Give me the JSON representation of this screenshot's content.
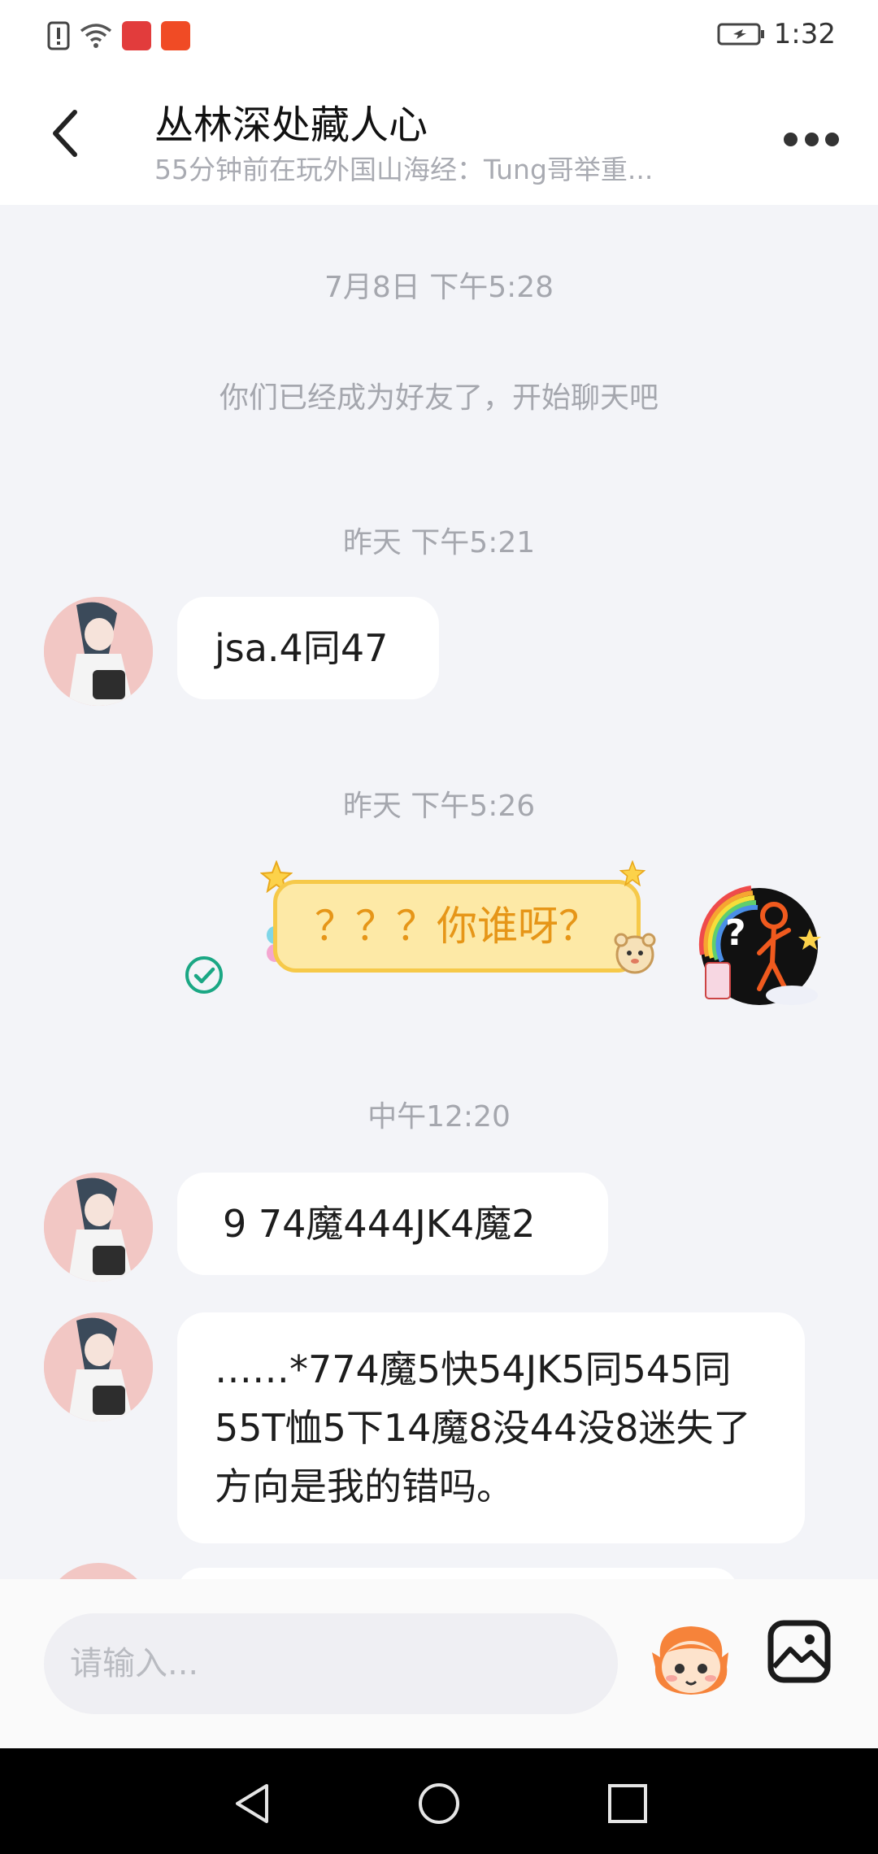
{
  "status_bar": {
    "time": "1:32",
    "icons": [
      "alert-icon",
      "wifi-icon",
      "huawei-app-icon",
      "app-icon",
      "battery-icon"
    ]
  },
  "header": {
    "title": "丛林深处藏人心",
    "subtitle": "55分钟前在玩外国山海经：Tung哥举重...",
    "back_icon": "back-arrow-icon",
    "more_icon": "more-dots-icon"
  },
  "chat": {
    "messages": [
      {
        "type": "timestamp",
        "text": "7月8日 下午5:28"
      },
      {
        "type": "system",
        "text": "你们已经成为好友了，开始聊天吧"
      },
      {
        "type": "timestamp",
        "text": "昨天 下午5:21"
      },
      {
        "type": "received",
        "text": "jsa.4同47"
      },
      {
        "type": "timestamp",
        "text": "昨天 下午5:26"
      },
      {
        "type": "sent_sticker",
        "text": "？？？你谁呀？",
        "status": "sent"
      },
      {
        "type": "timestamp",
        "text": "中午12:20"
      },
      {
        "type": "received",
        "text": "9 74魔444JK4魔2"
      },
      {
        "type": "received",
        "text": "……*774魔5快54JK5同545同55T恤5下14魔8没44没8迷失了方向是我的错吗。"
      }
    ]
  },
  "input": {
    "placeholder": "请输入...",
    "value": ""
  },
  "nav_bar": {
    "buttons": [
      "back-triangle-icon",
      "home-circle-icon",
      "recents-square-icon"
    ]
  },
  "colors": {
    "chat_bg": "#f3f4f8",
    "sticker_fill": "#fde9a6",
    "sticker_text": "#e69618",
    "check_green": "#1aa784",
    "timestamp_gray": "#a5a7ae"
  }
}
